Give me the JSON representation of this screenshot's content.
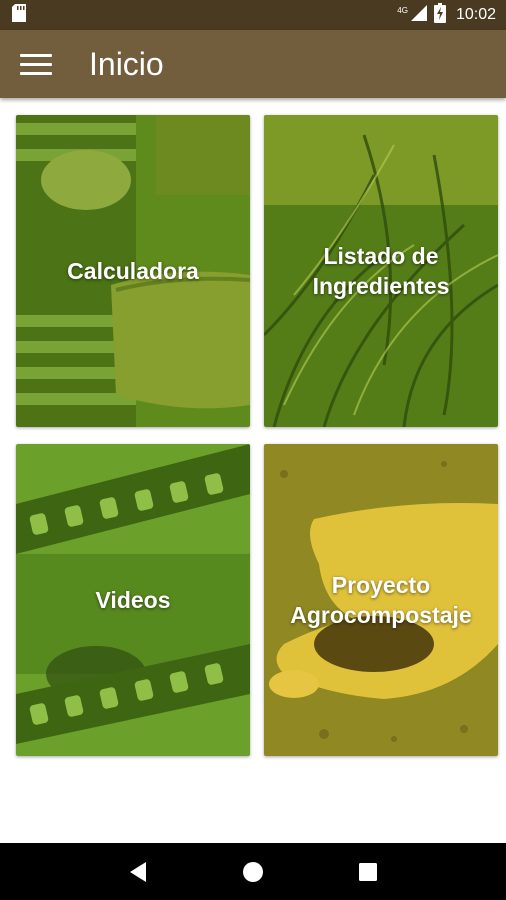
{
  "status_bar": {
    "time": "10:02",
    "network": "4G",
    "icons": [
      "sd-card-icon",
      "signal-icon",
      "battery-icon"
    ]
  },
  "app_bar": {
    "title": "Inicio",
    "menu_icon": "hamburger-menu-icon"
  },
  "cards": [
    {
      "label": "Calculadora"
    },
    {
      "label": "Listado de Ingredientes"
    },
    {
      "label": "Videos"
    },
    {
      "label": "Proyecto Agrocompostaje"
    }
  ],
  "nav_bar": {
    "icons": [
      "back-icon",
      "home-icon",
      "recents-icon"
    ]
  },
  "colors": {
    "status_bar": "#4a3a22",
    "app_bar": "#725d3d",
    "card_overlay_green": "#6b9a1e",
    "card_overlay_olive": "#a3a12a"
  }
}
